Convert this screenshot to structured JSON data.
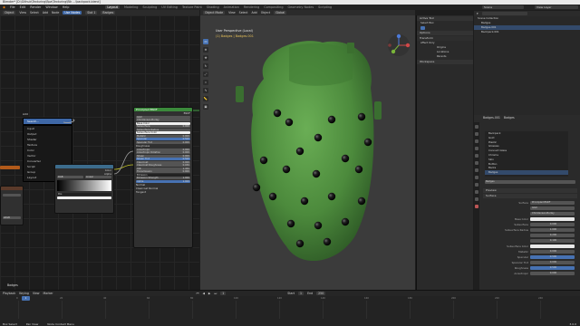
{
  "app": {
    "title": "Blender* [D:\\Github\\Texturing\\Bpa\\Texturing\\Blk ...\\backpack.blend]"
  },
  "menubar": {
    "items": [
      "File",
      "Edit",
      "Render",
      "Window",
      "Help"
    ],
    "workspaces": [
      "Layout",
      "Modeling",
      "Sculpting",
      "UV Editing",
      "Texture Paint",
      "Shading",
      "Animation",
      "Rendering",
      "Compositing",
      "Geometry Nodes",
      "Scripting"
    ],
    "active_workspace": "Layout",
    "scene": "Scene",
    "view_layer": "View Layer"
  },
  "node_editor": {
    "header": {
      "editor": "Object",
      "menus": [
        "View",
        "Select",
        "Add",
        "Node"
      ],
      "use_nodes": "Use Nodes",
      "slot": "Slot 1",
      "material": "Badges"
    },
    "add_menu": {
      "search_label": "Search...",
      "title": "Add",
      "items": [
        "Input",
        "Output",
        "Shader",
        "Texture",
        "Color",
        "Vector",
        "Converter",
        "Script",
        "Group",
        "Layout"
      ]
    },
    "bsdf_node": {
      "title": "Principled BSDF",
      "output": "BSDF",
      "distribution": "GGX",
      "subsurface_method": "Christensen-Burley",
      "rows": [
        {
          "label": "Base Color",
          "value": "",
          "style": "white"
        },
        {
          "label": "Subsurface",
          "value": "0.000",
          "style": "plain"
        },
        {
          "label": "Subsurface Radius",
          "value": "",
          "style": "plain"
        },
        {
          "label": "Subsurface Color",
          "value": "",
          "style": "white"
        },
        {
          "label": "Metallic",
          "value": "0.000",
          "style": "plain"
        },
        {
          "label": "Specular",
          "value": "0.500",
          "style": "blue"
        },
        {
          "label": "Specular Tint",
          "value": "0.000",
          "style": "plain"
        },
        {
          "label": "Roughness",
          "value": "",
          "style": "label"
        },
        {
          "label": "Anisotropic",
          "value": "0.000",
          "style": "plain"
        },
        {
          "label": "Anisotropic Rotation",
          "value": "0.000",
          "style": "plain"
        },
        {
          "label": "Sheen",
          "value": "0.000",
          "style": "plain"
        },
        {
          "label": "Sheen Tint",
          "value": "0.500",
          "style": "blue"
        },
        {
          "label": "Clearcoat",
          "value": "0.000",
          "style": "plain"
        },
        {
          "label": "Clearcoat Roughness",
          "value": "0.030",
          "style": "plain"
        },
        {
          "label": "IOR",
          "value": "1.450",
          "style": "plain"
        },
        {
          "label": "Transmission",
          "value": "0.000",
          "style": "plain"
        },
        {
          "label": "Emission",
          "value": "",
          "style": "dark"
        },
        {
          "label": "Emission Strength",
          "value": "1.000",
          "style": "plain"
        },
        {
          "label": "Alpha",
          "value": "1.000",
          "style": "blue"
        },
        {
          "label": "Normal",
          "value": "",
          "style": "label"
        },
        {
          "label": "Clearcoat Normal",
          "value": "",
          "style": "label"
        },
        {
          "label": "Tangent",
          "value": "",
          "style": "label"
        }
      ]
    },
    "ramp_node": {
      "outputs": [
        "Color",
        "Alpha"
      ],
      "mode": "RGB",
      "interpolation": "Linear",
      "pos": "Pos"
    },
    "left_node": {
      "field": "sRGB"
    },
    "footer_label": "Badges"
  },
  "viewport": {
    "header": {
      "mode": "Object Mode",
      "menus": [
        "View",
        "Select",
        "Add",
        "Object"
      ],
      "transform": "Global"
    },
    "overlay_line1": "User Perspective (Local)",
    "overlay_line2": "(1) Badges | Badges.001",
    "colors": {
      "mesh": "#4c8a3c",
      "rivet": "#1a1a1a"
    }
  },
  "npanel": {
    "active_tool_title": "Active Tool",
    "select_box": "Select Box",
    "options_title": "Options",
    "transform_title": "Transform",
    "affect_only": "Affect Only",
    "affect_items": [
      "Origins",
      "Locations",
      "Parents"
    ],
    "workspace_title": "Workspace",
    "tabs": [
      "Item",
      "Tool",
      "View"
    ]
  },
  "outliner": {
    "search_placeholder": "",
    "rows": [
      "Scene Collection",
      "Badges",
      "Badges.001",
      "Backpack.001"
    ]
  },
  "properties": {
    "header_object": "Badges.001",
    "header_material": "Badges",
    "slots": [
      "Backpack",
      "Gold",
      "Plastic",
      "Glossies",
      "Connect Glass",
      "Chrome",
      "Skin",
      "Button",
      "Backs",
      "Badges"
    ],
    "active_slot": "Badges",
    "material_name": "Badges",
    "preview": "Preview",
    "surface": "Surface",
    "surface_type": "Principled BSDF",
    "distribution": "GGX",
    "subsurface_method": "Christensen-Burley",
    "rows": [
      {
        "label": "Base Color",
        "value": "",
        "style": "white"
      },
      {
        "label": "Subsurface",
        "value": "0.000",
        "style": "plain"
      },
      {
        "label": "Subsurface Radius",
        "value": "1.000",
        "style": "plain"
      },
      {
        "label": "",
        "value": "0.200",
        "style": "plain"
      },
      {
        "label": "",
        "value": "0.100",
        "style": "plain"
      },
      {
        "label": "Subsurface Color",
        "value": "",
        "style": "white"
      },
      {
        "label": "Metallic",
        "value": "0.000",
        "style": "plain"
      },
      {
        "label": "Specular",
        "value": "0.500",
        "style": "blue"
      },
      {
        "label": "Specular Tint",
        "value": "0.000",
        "style": "plain"
      },
      {
        "label": "Roughness",
        "value": "0.500",
        "style": "blue"
      },
      {
        "label": "Anisotropic",
        "value": "0.000",
        "style": "plain"
      }
    ]
  },
  "timeline": {
    "menus": [
      "Playback",
      "Keying",
      "View",
      "Marker"
    ],
    "current_frame": "1",
    "start_label": "Start",
    "start": "1",
    "end_label": "End",
    "end": "250",
    "ticks": [
      "0",
      "20",
      "40",
      "60",
      "80",
      "100",
      "120",
      "140",
      "160",
      "180",
      "200",
      "220",
      "240"
    ]
  },
  "statusbar": {
    "items": [
      "Box Select",
      "Pan View",
      "Node Context Menu"
    ],
    "version": "3.0.0"
  }
}
